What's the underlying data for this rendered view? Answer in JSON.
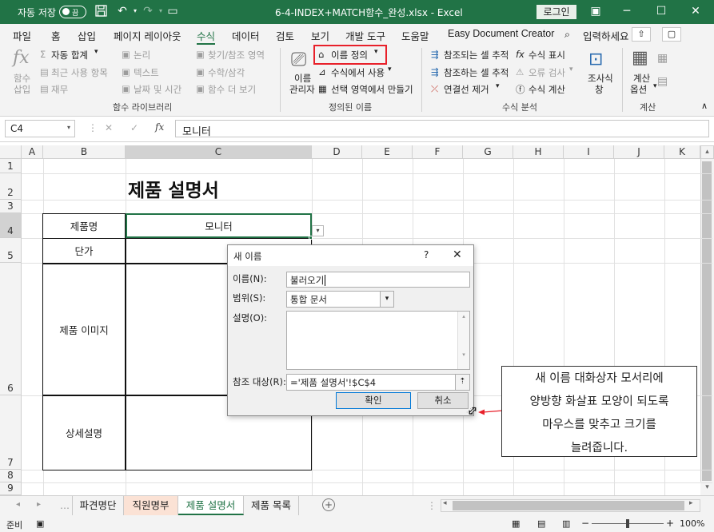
{
  "titlebar": {
    "autosave_label": "자동 저장",
    "autosave_state": "끔",
    "filename": "6-4-INDEX+MATCH함수_완성.xlsx  -  Excel",
    "login_label": "로그인"
  },
  "menu": {
    "items": [
      "파일",
      "홈",
      "삽입",
      "페이지 레이아웃",
      "수식",
      "데이터",
      "검토",
      "보기",
      "개발 도구",
      "도움말",
      "Easy Document Creator"
    ],
    "search_label": "입력하세요",
    "active": "수식"
  },
  "ribbon": {
    "fx_insert_label": "함수\n삽입",
    "fx_insert_line1": "함수",
    "fx_insert_line2": "삽입",
    "autosum": "자동 합계",
    "recent": "최근 사용 항목",
    "finance": "재무",
    "logic": "논리",
    "text": "텍스트",
    "datetime": "날짜 및 시간",
    "lookup": "찾기/참조 영역",
    "math": "수학/삼각",
    "more": "함수 더 보기",
    "group_library": "함수 라이브러리",
    "name_manager_line1": "이름",
    "name_manager_line2": "관리자",
    "define_name": "이름 정의",
    "use_in_formula": "수식에서 사용",
    "create_from_selection": "선택 영역에서 만들기",
    "group_defined_names": "정의된 이름",
    "trace_precedents": "참조되는 셀 추적",
    "trace_dependents": "참조하는 셀 추적",
    "remove_arrows": "연결선 제거",
    "show_formulas": "수식 표시",
    "error_checking": "오류 검사",
    "evaluate_formula": "수식 계산",
    "watch_line1": "조사식",
    "watch_line2": "창",
    "group_auditing": "수식 분석",
    "calc_options_line1": "계산",
    "calc_options_line2": "옵션",
    "group_calculation": "계산"
  },
  "formula_bar": {
    "name_box": "C4",
    "fx_label": "fx",
    "content": "모니터"
  },
  "columns": [
    "A",
    "B",
    "C",
    "D",
    "E",
    "F",
    "G",
    "H",
    "I",
    "J",
    "K"
  ],
  "rows": [
    "1",
    "2",
    "3",
    "4",
    "5",
    "6",
    "7",
    "8",
    "9"
  ],
  "sheet": {
    "title": "제품 설명서",
    "label_product_name": "제품명",
    "value_product_name": "모니터",
    "label_price": "단가",
    "label_image": "제품 이미지",
    "label_detail": "상세설명"
  },
  "dialog": {
    "title": "새 이름",
    "help": "?",
    "close": "✕",
    "name_label": "이름(N):",
    "name_value": "불러오기",
    "scope_label": "범위(S):",
    "scope_value": "통합 문서",
    "comment_label": "설명(O):",
    "refers_label": "참조 대상(R):",
    "refers_value": "='제품 설명서'!$C$4",
    "ok": "확인",
    "cancel": "취소"
  },
  "callout": {
    "lines": [
      "새 이름 대화상자 모서리에",
      "양방향 화살표 모양이 되도록",
      "마우스를 맞추고 크기를",
      "늘려줍니다."
    ]
  },
  "sheet_tabs": [
    "파견명단",
    "직원명부",
    "제품 설명서",
    "제품 목록"
  ],
  "active_tab": "제품 설명서",
  "status": {
    "ready": "준비",
    "zoom": "100%"
  },
  "colors": {
    "excel_green": "#217346",
    "highlight_red": "#e8202a",
    "callout_arrow": "#e8202a"
  }
}
